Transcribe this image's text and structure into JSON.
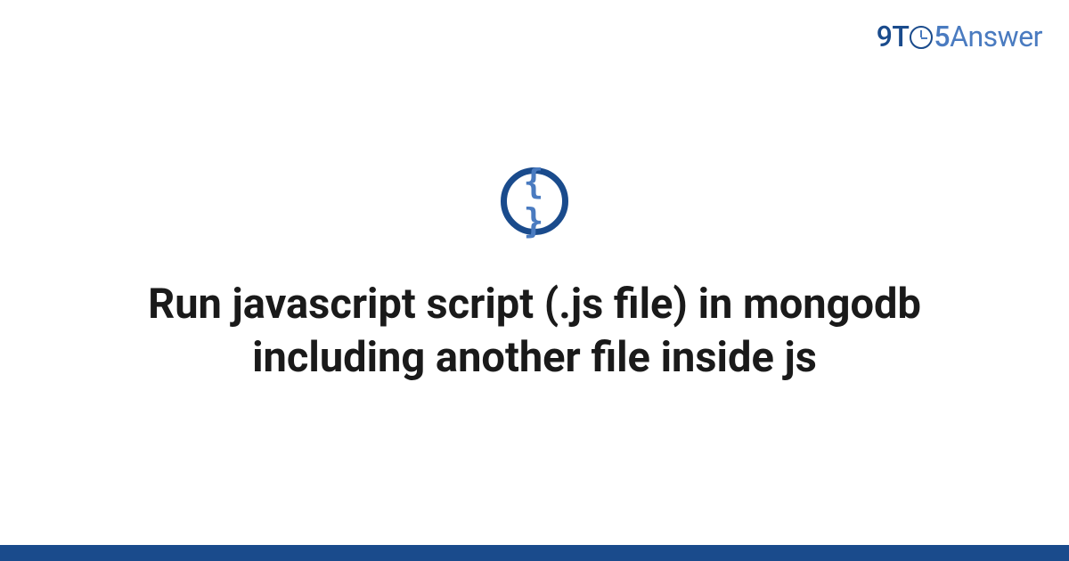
{
  "logo": {
    "part1": "9",
    "part2": "T",
    "part3": "5",
    "part4": "Answer"
  },
  "icon": {
    "name": "code-braces-icon",
    "glyph": "{ }"
  },
  "title": "Run javascript script (.js file) in mongodb including another file inside js",
  "colors": {
    "primary": "#1a4b8c",
    "secondary": "#4a7bc0",
    "text": "#1a1a1a"
  }
}
